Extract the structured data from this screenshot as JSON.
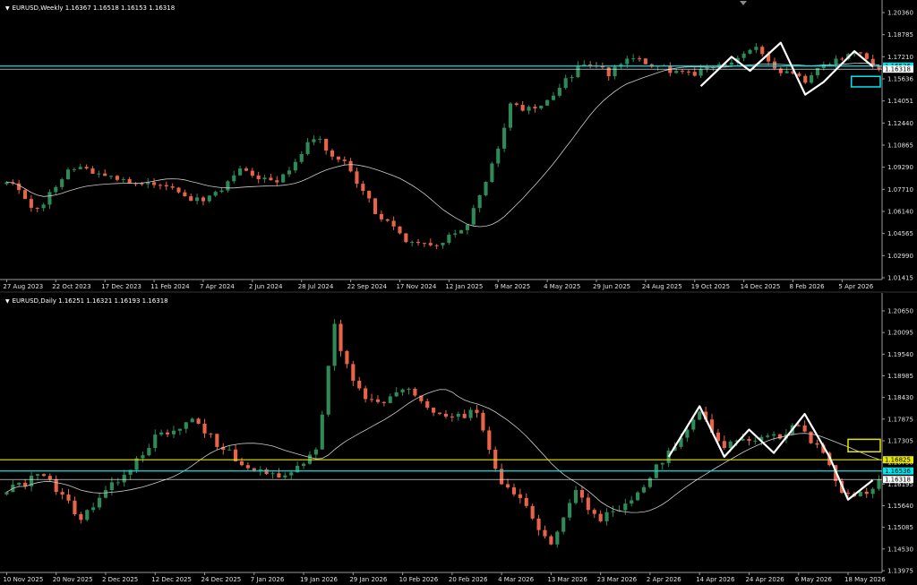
{
  "colors": {
    "background": "#000000",
    "bull": "#2e8b57",
    "bear": "#e8634a",
    "ma": "#cccccc",
    "axis": "#9a9a9a",
    "cyan": "#00e5ee",
    "yellow": "#e6e600",
    "white": "#ffffff"
  },
  "chart_data": [
    {
      "type": "candlestick",
      "panel": "weekly",
      "title": "EURUSD,Weekly  1.16367 1.16518 1.16153 1.16318",
      "y_ticks": [
        "1.20360",
        "1.18785",
        "1.17210",
        "1.15636",
        "1.14051",
        "1.12440",
        "1.10865",
        "1.09290",
        "1.07710",
        "1.06140",
        "1.04565",
        "1.02990",
        "1.01415"
      ],
      "ylim": [
        1.01415,
        1.2036
      ],
      "x_ticks": [
        "27 Aug 2023",
        "22 Oct 2023",
        "17 Dec 2023",
        "11 Feb 2024",
        "7 Apr 2024",
        "2 Jun 2024",
        "28 Jul 2024",
        "22 Sep 2024",
        "17 Nov 2024",
        "12 Jan 2025",
        "9 Mar 2025",
        "4 May 2025",
        "29 Jun 2025",
        "24 Aug 2025",
        "19 Oct 2025",
        "14 Dec 2025",
        "8 Feb 2026",
        "5 Apr 2026"
      ],
      "x_tick_index": [
        0,
        8,
        16,
        24,
        32,
        40,
        48,
        56,
        64,
        72,
        80,
        88,
        96,
        104,
        112,
        120,
        128,
        136
      ],
      "candle_count": 143,
      "price_path_anchors": [
        [
          0,
          1.085
        ],
        [
          5,
          1.062
        ],
        [
          10,
          1.092
        ],
        [
          15,
          1.09
        ],
        [
          20,
          1.082
        ],
        [
          26,
          1.078
        ],
        [
          32,
          1.068
        ],
        [
          38,
          1.09
        ],
        [
          44,
          1.08
        ],
        [
          50,
          1.115
        ],
        [
          55,
          1.095
        ],
        [
          60,
          1.062
        ],
        [
          65,
          1.042
        ],
        [
          70,
          1.038
        ],
        [
          75,
          1.052
        ],
        [
          78,
          1.08
        ],
        [
          82,
          1.138
        ],
        [
          86,
          1.134
        ],
        [
          90,
          1.15
        ],
        [
          94,
          1.168
        ],
        [
          98,
          1.16
        ],
        [
          102,
          1.172
        ],
        [
          106,
          1.165
        ],
        [
          110,
          1.16
        ],
        [
          114,
          1.162
        ],
        [
          118,
          1.17
        ],
        [
          122,
          1.178
        ],
        [
          126,
          1.162
        ],
        [
          130,
          1.155
        ],
        [
          134,
          1.168
        ],
        [
          138,
          1.176
        ],
        [
          141,
          1.164
        ],
        [
          142,
          1.1632
        ]
      ],
      "ma_period": 20,
      "horizontal_lines": [
        {
          "price": 1.16536,
          "color": "cyan",
          "label": "1.16536"
        },
        {
          "price": 1.16318,
          "color": "white",
          "label": "1.16318"
        }
      ],
      "price_labels": [
        "1.16536",
        "1.16318"
      ],
      "zigzag": [
        [
          113,
          1.151
        ],
        [
          118,
          1.172
        ],
        [
          121,
          1.162
        ],
        [
          126,
          1.182
        ],
        [
          130,
          1.145
        ],
        [
          133,
          1.154
        ],
        [
          138,
          1.176
        ],
        [
          141,
          1.165
        ]
      ],
      "box": {
        "color": "cyan",
        "index_from": 137.5,
        "index_to": 147,
        "price_from": 1.158,
        "price_to": 1.1505
      }
    },
    {
      "type": "candlestick",
      "panel": "daily",
      "title": "EURUSD,Daily  1.16251 1.16321 1.16193 1.16318",
      "y_ticks": [
        "1.20650",
        "1.20095",
        "1.19540",
        "1.18985",
        "1.18430",
        "1.17875",
        "1.17305",
        "1.16750",
        "1.16195",
        "1.15640",
        "1.15085",
        "1.14530",
        "1.13975"
      ],
      "ylim": [
        1.13975,
        1.2065
      ],
      "x_ticks": [
        "10 Nov 2025",
        "20 Nov 2025",
        "2 Dec 2025",
        "12 Dec 2025",
        "24 Dec 2025",
        "7 Jan 2026",
        "19 Jan 2026",
        "29 Jan 2026",
        "10 Feb 2026",
        "20 Feb 2026",
        "4 Mar 2026",
        "13 Mar 2026",
        "23 Mar 2026",
        "2 Apr 2026",
        "14 Apr 2026",
        "24 Apr 2026",
        "6 May 2026",
        "18 May 2026"
      ],
      "x_tick_index": [
        0,
        8,
        16,
        24,
        32,
        40,
        48,
        56,
        64,
        72,
        80,
        88,
        96,
        104,
        112,
        120,
        128,
        136
      ],
      "candle_count": 142,
      "price_path_anchors": [
        [
          0,
          1.161
        ],
        [
          6,
          1.164
        ],
        [
          12,
          1.153
        ],
        [
          18,
          1.163
        ],
        [
          24,
          1.174
        ],
        [
          30,
          1.178
        ],
        [
          36,
          1.17
        ],
        [
          42,
          1.164
        ],
        [
          46,
          1.164
        ],
        [
          50,
          1.17
        ],
        [
          53,
          1.202
        ],
        [
          56,
          1.188
        ],
        [
          60,
          1.182
        ],
        [
          64,
          1.187
        ],
        [
          68,
          1.182
        ],
        [
          72,
          1.18
        ],
        [
          76,
          1.18
        ],
        [
          80,
          1.162
        ],
        [
          84,
          1.156
        ],
        [
          88,
          1.146
        ],
        [
          92,
          1.16
        ],
        [
          96,
          1.153
        ],
        [
          100,
          1.156
        ],
        [
          104,
          1.164
        ],
        [
          108,
          1.172
        ],
        [
          112,
          1.18
        ],
        [
          116,
          1.172
        ],
        [
          120,
          1.173
        ],
        [
          124,
          1.174
        ],
        [
          128,
          1.177
        ],
        [
          132,
          1.17
        ],
        [
          135,
          1.16
        ],
        [
          138,
          1.159
        ],
        [
          141,
          1.1632
        ]
      ],
      "ma_period": 20,
      "horizontal_lines": [
        {
          "price": 1.16825,
          "color": "yellow",
          "label": "1.16825"
        },
        {
          "price": 1.16536,
          "color": "cyan",
          "label": "1.16536"
        },
        {
          "price": 1.16318,
          "color": "white",
          "label": "1.16318"
        }
      ],
      "price_labels": [
        "1.16825",
        "1.16536",
        "1.16318"
      ],
      "zigzag": [
        [
          107,
          1.169
        ],
        [
          112,
          1.182
        ],
        [
          116,
          1.169
        ],
        [
          120,
          1.176
        ],
        [
          124,
          1.17
        ],
        [
          129,
          1.18
        ],
        [
          133,
          1.169
        ],
        [
          136,
          1.158
        ],
        [
          140,
          1.163
        ]
      ],
      "box": {
        "color": "yellow",
        "index_from": 136,
        "index_to": 146,
        "price_from": 1.1735,
        "price_to": 1.1703
      }
    }
  ]
}
